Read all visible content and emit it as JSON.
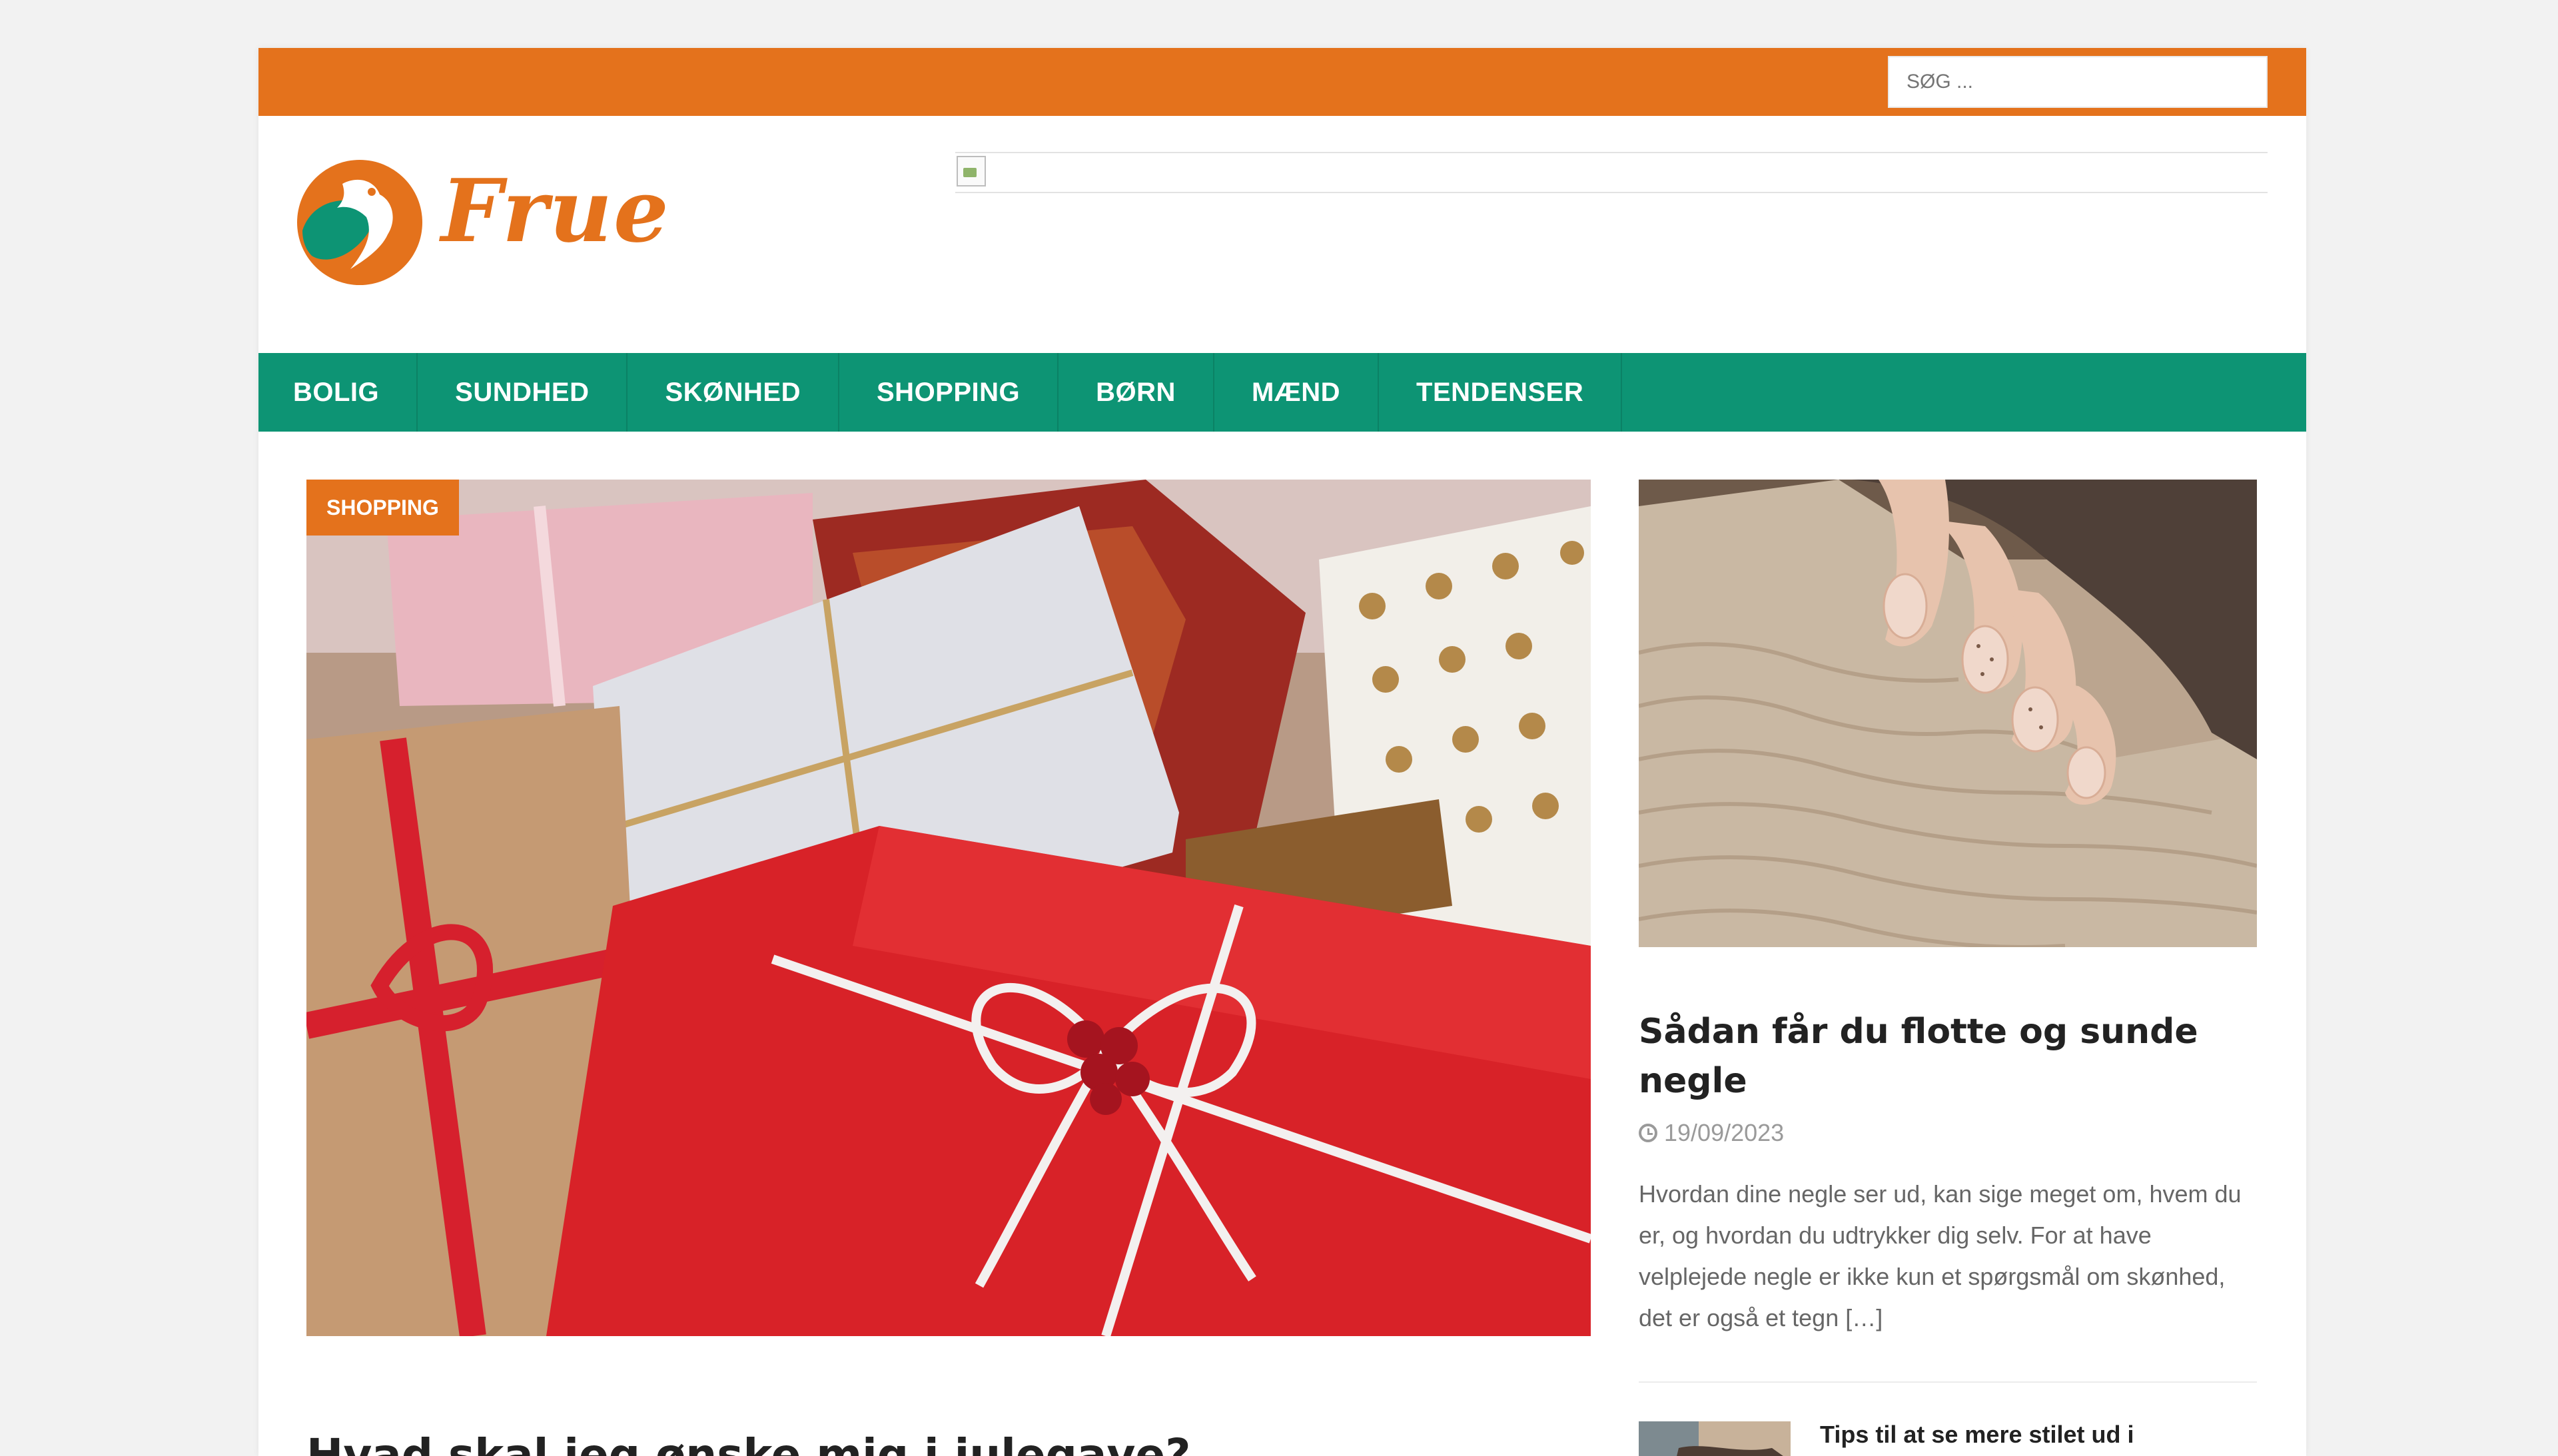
{
  "search": {
    "placeholder": "SØG ..."
  },
  "brand": {
    "name": "Frue",
    "colors": {
      "orange": "#e4721c",
      "green": "#0d9474"
    },
    "logo_icon": "bird-leaf-icon"
  },
  "nav": {
    "items": [
      {
        "label": "BOLIG"
      },
      {
        "label": "SUNDHED"
      },
      {
        "label": "SKØNHED"
      },
      {
        "label": "SHOPPING"
      },
      {
        "label": "BØRN"
      },
      {
        "label": "MÆND"
      },
      {
        "label": "TENDENSER"
      }
    ]
  },
  "featured": {
    "category": "SHOPPING",
    "title": "Hvad skal jeg ønske mig i julegave?",
    "image": "christmas-gifts-photo"
  },
  "side_post": {
    "image": "knitted-sweater-nails-photo",
    "title": "Sådan får du flotte og sunde negle",
    "date": "19/09/2023",
    "excerpt": "Hvordan dine negle ser ud, kan sige meget om, hvem du er, og hvordan du udtrykker dig selv. For at have velplejede negle er ikke kun et spørgsmål om skønhed, det er også et tegn […]"
  },
  "small_post": {
    "image": "style-thumbnail-photo",
    "title": "Tips til at se mere stilet ud i hverdagen"
  }
}
